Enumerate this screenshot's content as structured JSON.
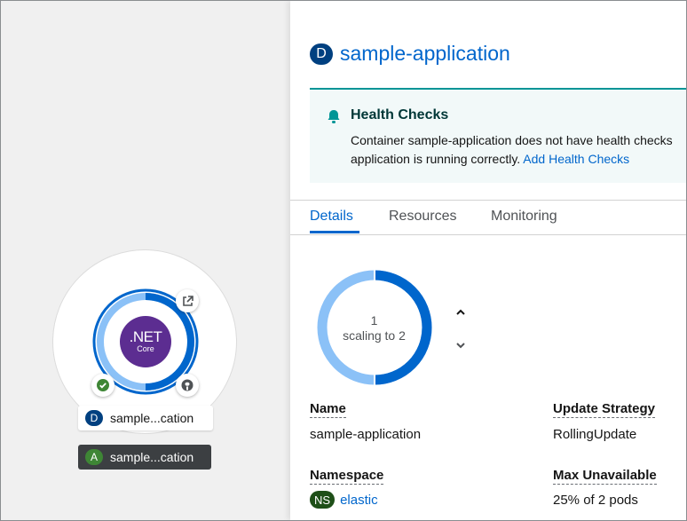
{
  "topology": {
    "deployment_badge": "D",
    "deployment_label": "sample...cation",
    "application_badge": "A",
    "application_label": "sample...cation",
    "runtime_name": ".NET",
    "runtime_sub": "Core"
  },
  "panel": {
    "resource_badge": "D",
    "resource_name": "sample-application",
    "alert": {
      "title": "Health Checks",
      "line1": "Container sample-application does not have health checks",
      "line2": "application is running correctly.",
      "link": "Add Health Checks"
    },
    "tabs": [
      {
        "label": "Details",
        "active": true
      },
      {
        "label": "Resources",
        "active": false
      },
      {
        "label": "Monitoring",
        "active": false
      }
    ],
    "pods": {
      "count": "1",
      "status": "scaling to 2"
    },
    "details": {
      "name_label": "Name",
      "name_value": "sample-application",
      "strategy_label": "Update Strategy",
      "strategy_value": "RollingUpdate",
      "namespace_label": "Namespace",
      "namespace_badge": "NS",
      "namespace_value": "elastic",
      "max_unavailable_label": "Max Unavailable",
      "max_unavailable_value": "25% of 2 pods"
    }
  },
  "colors": {
    "link": "#0066cc",
    "pod_running": "#0066cc",
    "pod_pending": "#8bc1f7",
    "dotnet": "#5c2d91",
    "alert_border": "#009596"
  }
}
